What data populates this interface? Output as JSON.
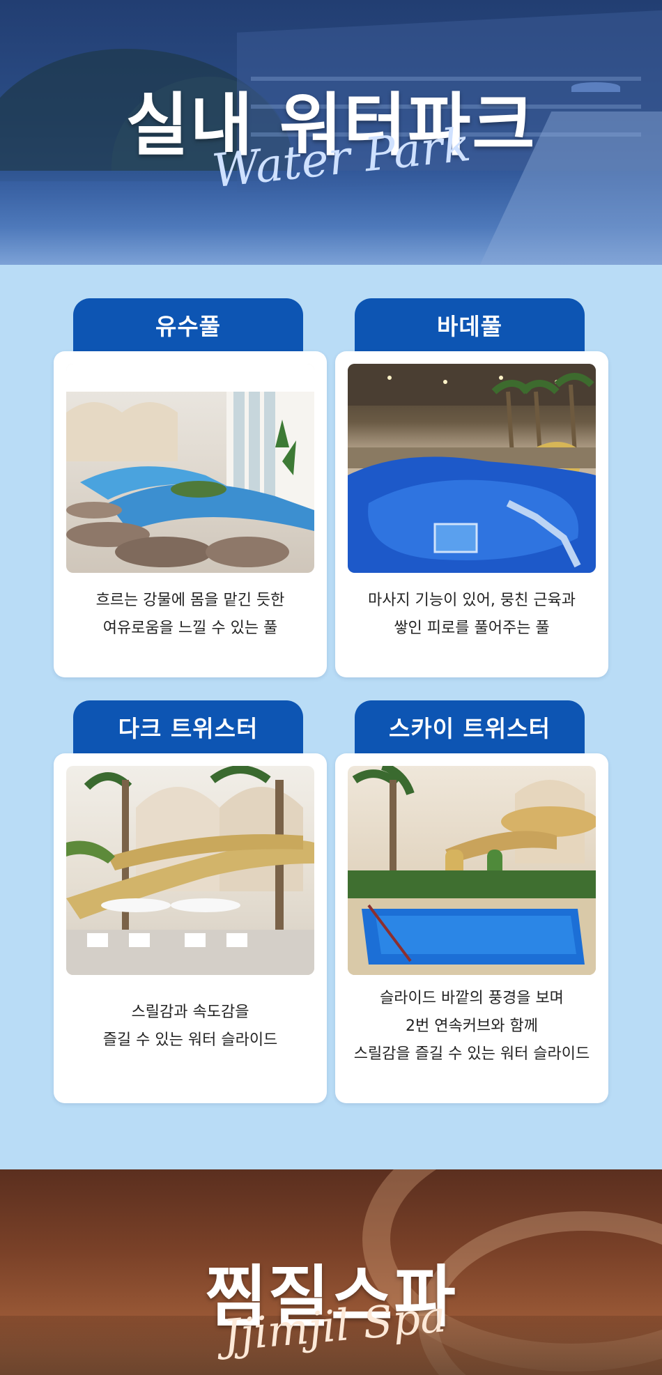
{
  "hero": {
    "title": "실내 워터파크",
    "subtitle": "Water Park"
  },
  "attractions": [
    {
      "name": "유수풀",
      "desc_lines": [
        "흐르는 강물에 몸을 맡긴 듯한",
        "여유로움을 느낄 수 있는 풀"
      ]
    },
    {
      "name": "바데풀",
      "desc_lines": [
        "마사지 기능이 있어, 뭉친 근육과",
        "쌓인 피로를 풀어주는 풀"
      ]
    },
    {
      "name": "다크 트위스터",
      "desc_lines": [
        "스릴감과 속도감을",
        "즐길 수 있는 워터 슬라이드"
      ]
    },
    {
      "name": "스카이 트위스터",
      "desc_lines": [
        "슬라이드 바깥의 풍경을 보며",
        "2번 연속커브와 함께",
        "스릴감을 즐길 수 있는 워터 슬라이드"
      ]
    }
  ],
  "spa": {
    "title": "찜질스파",
    "subtitle": "Jjimjil Spa"
  },
  "colors": {
    "background": "#b9dcf6",
    "tab": "#0d55b3",
    "card": "#ffffff"
  }
}
